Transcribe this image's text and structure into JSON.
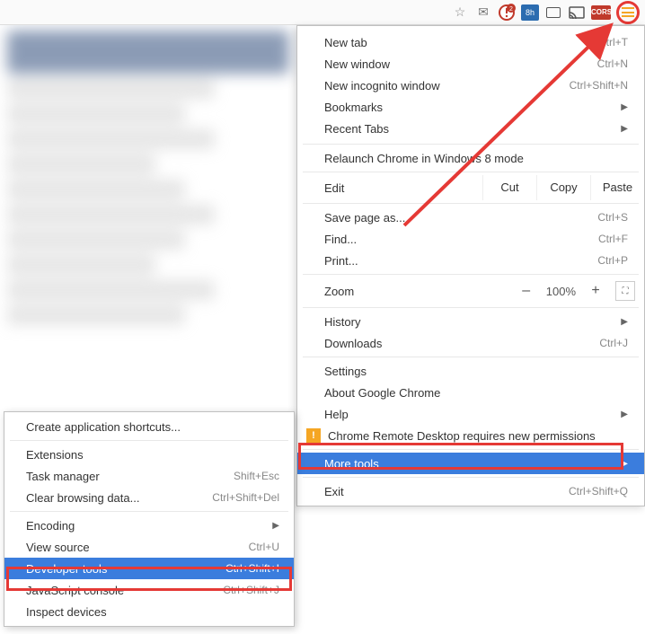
{
  "toolbar": {
    "bluebox_text": "8h",
    "cors_text": "CORS",
    "badge_count": "2"
  },
  "menu": {
    "new_tab": "New tab",
    "new_tab_sc": "Ctrl+T",
    "new_window": "New window",
    "new_window_sc": "Ctrl+N",
    "new_incognito": "New incognito window",
    "new_incognito_sc": "Ctrl+Shift+N",
    "bookmarks": "Bookmarks",
    "recent_tabs": "Recent Tabs",
    "relaunch": "Relaunch Chrome in Windows 8 mode",
    "edit": "Edit",
    "cut": "Cut",
    "copy": "Copy",
    "paste": "Paste",
    "save_page": "Save page as...",
    "save_page_sc": "Ctrl+S",
    "find": "Find...",
    "find_sc": "Ctrl+F",
    "print": "Print...",
    "print_sc": "Ctrl+P",
    "zoom": "Zoom",
    "zoom_minus": "–",
    "zoom_value": "100%",
    "zoom_plus": "+",
    "history": "History",
    "downloads": "Downloads",
    "downloads_sc": "Ctrl+J",
    "settings": "Settings",
    "about": "About Google Chrome",
    "help": "Help",
    "warn_text": "Chrome Remote Desktop requires new permissions",
    "more_tools": "More tools",
    "exit": "Exit",
    "exit_sc": "Ctrl+Shift+Q"
  },
  "submenu": {
    "create_shortcuts": "Create application shortcuts...",
    "extensions": "Extensions",
    "task_manager": "Task manager",
    "task_manager_sc": "Shift+Esc",
    "clear_data": "Clear browsing data...",
    "clear_data_sc": "Ctrl+Shift+Del",
    "encoding": "Encoding",
    "view_source": "View source",
    "view_source_sc": "Ctrl+U",
    "dev_tools": "Developer tools",
    "dev_tools_sc": "Ctrl+Shift+I",
    "js_console": "JavaScript console",
    "js_console_sc": "Ctrl+Shift+J",
    "inspect_devices": "Inspect devices"
  }
}
